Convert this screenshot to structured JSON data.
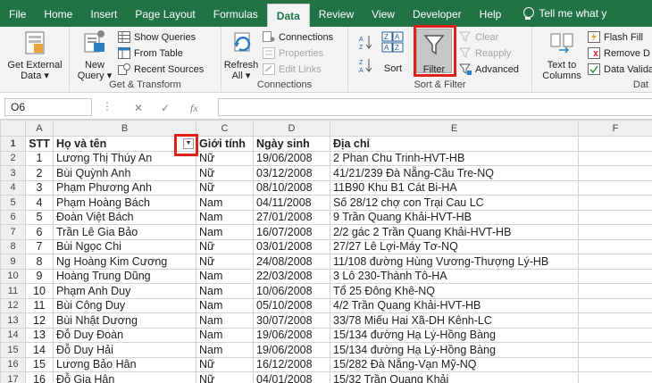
{
  "tabs": [
    "File",
    "Home",
    "Insert",
    "Page Layout",
    "Formulas",
    "Data",
    "Review",
    "View",
    "Developer",
    "Help"
  ],
  "active_tab": "Data",
  "tell_me": "Tell me what y",
  "ribbon": {
    "get_external": {
      "line1": "Get External",
      "line2": "Data ▾"
    },
    "new_query": {
      "line1": "New",
      "line2": "Query ▾"
    },
    "show_queries": "Show Queries",
    "from_table": "From Table",
    "recent_sources": "Recent Sources",
    "get_transform_label": "Get & Transform",
    "refresh": {
      "line1": "Refresh",
      "line2": "All ▾"
    },
    "connections": "Connections",
    "properties": "Properties",
    "edit_links": "Edit Links",
    "connections_label": "Connections",
    "sort": "Sort",
    "filter": "Filter",
    "clear": "Clear",
    "reapply": "Reapply",
    "advanced": "Advanced",
    "sort_filter_label": "Sort & Filter",
    "text_to_columns": {
      "line1": "Text to",
      "line2": "Columns"
    },
    "flash_fill": "Flash Fill",
    "remove_duplicates": "Remove D",
    "data_validation": "Data Valida",
    "data_tools_label": "Dat"
  },
  "formula_bar": {
    "name_box": "O6",
    "cancel": "✕",
    "enter": "✓",
    "fx": "fx",
    "value": ""
  },
  "columns": [
    "A",
    "B",
    "C",
    "D",
    "E",
    "F"
  ],
  "headers": {
    "stt": "STT",
    "name": "Họ và tên",
    "gender": "Giới tính",
    "dob": "Ngày sinh",
    "address": "Địa chỉ"
  },
  "rows": [
    {
      "r": "2",
      "stt": "1",
      "name": "Lương Thị Thúy An",
      "gender": "Nữ",
      "dob": "19/06/2008",
      "address": "2 Phan Chu Trinh-HVT-HB"
    },
    {
      "r": "3",
      "stt": "2",
      "name": "Bùi Quỳnh Anh",
      "gender": "Nữ",
      "dob": "03/12/2008",
      "address": "41/21/239 Đà Nẵng-Cầu Tre-NQ"
    },
    {
      "r": "4",
      "stt": "3",
      "name": "Phạm Phương Anh",
      "gender": "Nữ",
      "dob": "08/10/2008",
      "address": "11B90 Khu B1 Cát Bi-HA"
    },
    {
      "r": "5",
      "stt": "4",
      "name": "Phạm Hoàng Bách",
      "gender": "Nam",
      "dob": "04/11/2008",
      "address": "Số 28/12 chợ con Trại Cau LC"
    },
    {
      "r": "6",
      "stt": "5",
      "name": "Đoàn Việt Bách",
      "gender": "Nam",
      "dob": "27/01/2008",
      "address": "9 Trần Quang Khải-HVT-HB"
    },
    {
      "r": "7",
      "stt": "6",
      "name": "Trần Lê Gia Bảo",
      "gender": "Nam",
      "dob": "16/07/2008",
      "address": "2/2 gác 2 Trần Quang Khải-HVT-HB"
    },
    {
      "r": "8",
      "stt": "7",
      "name": "Bùi Ngọc Chi",
      "gender": "Nữ",
      "dob": "03/01/2008",
      "address": "27/27 Lê Lợi-Máy Tơ-NQ"
    },
    {
      "r": "9",
      "stt": "8",
      "name": "Ng Hoàng Kim Cương",
      "gender": "Nữ",
      "dob": "24/08/2008",
      "address": "11/108 đường Hùng Vương-Thượng Lý-HB"
    },
    {
      "r": "10",
      "stt": "9",
      "name": "Hoàng Trung Dũng",
      "gender": "Nam",
      "dob": "22/03/2008",
      "address": "3 Lô 230-Thành Tô-HA"
    },
    {
      "r": "11",
      "stt": "10",
      "name": "Phạm Anh Duy",
      "gender": "Nam",
      "dob": "10/06/2008",
      "address": "Tổ 25 Đông Khê-NQ"
    },
    {
      "r": "12",
      "stt": "11",
      "name": "Bùi Công Duy",
      "gender": "Nam",
      "dob": "05/10/2008",
      "address": "4/2 Trần Quang Khải-HVT-HB"
    },
    {
      "r": "13",
      "stt": "12",
      "name": "Bùi Nhật Dương",
      "gender": "Nam",
      "dob": "30/07/2008",
      "address": "33/78 Miếu Hai Xã-DH Kênh-LC"
    },
    {
      "r": "14",
      "stt": "13",
      "name": "Đỗ Duy Đoàn",
      "gender": "Nam",
      "dob": "19/06/2008",
      "address": "15/134 đường Hạ Lý-Hồng Bàng"
    },
    {
      "r": "15",
      "stt": "14",
      "name": "Đỗ Duy Hải",
      "gender": "Nam",
      "dob": "19/06/2008",
      "address": "15/134 đường Hạ Lý-Hồng Bàng"
    },
    {
      "r": "16",
      "stt": "15",
      "name": "Lương Bảo Hân",
      "gender": "Nữ",
      "dob": "16/12/2008",
      "address": "15/282 Đà Nẵng-Vạn Mỹ-NQ"
    },
    {
      "r": "17",
      "stt": "16",
      "name": "Đỗ Gia Hân",
      "gender": "Nữ",
      "dob": "04/01/2008",
      "address": "15/32 Trần Quang Khải"
    }
  ]
}
